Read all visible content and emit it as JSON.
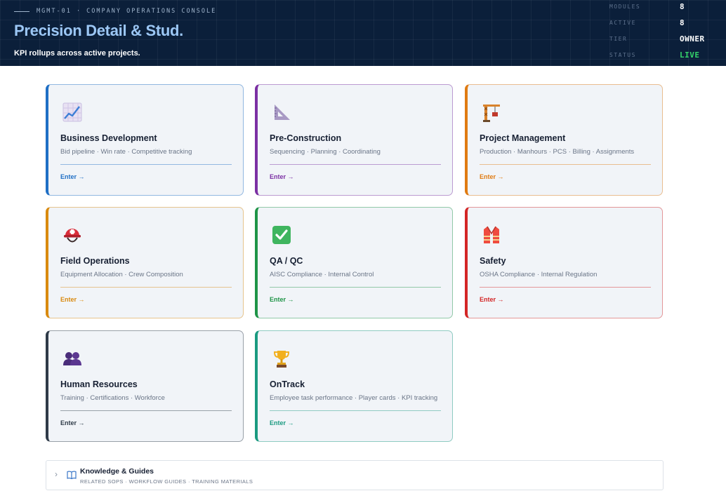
{
  "header": {
    "eyebrow": "MGMT-01 · COMPANY OPERATIONS CONSOLE",
    "company": "Precision Detail & Stud.",
    "subtitle": "KPI rollups across active projects.",
    "stats": [
      {
        "label": "MODULES",
        "value": "8"
      },
      {
        "label": "ACTIVE",
        "value": "8"
      },
      {
        "label": "TIER",
        "value": "OWNER"
      },
      {
        "label": "STATUS",
        "value": "LIVE"
      }
    ]
  },
  "cards": [
    {
      "title": "Business Development",
      "desc": "Bid pipeline · Win rate · Competitive tracking",
      "enter": "Enter →",
      "icon": "chart-increasing-icon",
      "accent": "#1f6fc5"
    },
    {
      "title": "Pre-Construction",
      "desc": "Sequencing · Planning · Coordinating",
      "enter": "Enter →",
      "icon": "triangular-ruler-icon",
      "accent": "#7b2fa3"
    },
    {
      "title": "Project Management",
      "desc": "Production · Manhours · PCS · Billing · Assignments",
      "enter": "Enter →",
      "icon": "crane-icon",
      "accent": "#e07b12"
    },
    {
      "title": "Field Operations",
      "desc": "Equipment Allocation · Crew Composition",
      "enter": "Enter →",
      "icon": "rescue-worker-helmet-icon",
      "accent": "#d98a0f"
    },
    {
      "title": "QA / QC",
      "desc": "AISC Compliance · Internal Control",
      "enter": "Enter →",
      "icon": "check-mark-button-icon",
      "accent": "#1f9447"
    },
    {
      "title": "Safety",
      "desc": "OSHA Compliance · Internal Regulation",
      "enter": "Enter →",
      "icon": "safety-vest-icon",
      "accent": "#d32626"
    },
    {
      "title": "Human Resources",
      "desc": "Training · Certifications · Workforce",
      "enter": "Enter →",
      "icon": "people-icon",
      "accent": "#2f3b48"
    },
    {
      "title": "OnTrack",
      "desc": "Employee task performance · Player cards · KPI tracking",
      "enter": "Enter →",
      "icon": "trophy-icon",
      "accent": "#1a9a80"
    }
  ],
  "knowledge": {
    "title": "Knowledge & Guides",
    "subtitle": "RELATED SOPS · WORKFLOW GUIDES · TRAINING MATERIALS",
    "chevron": "chevron-right-icon",
    "icon": "open-book-icon"
  }
}
